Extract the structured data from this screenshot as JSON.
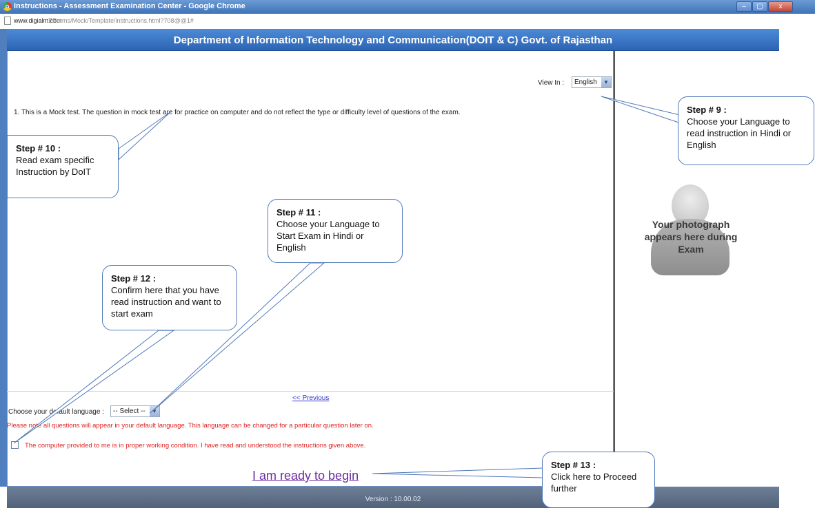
{
  "window": {
    "title": "Instructions - Assessment Examination Center - Google Chrome",
    "buttons": {
      "minimize": "–",
      "maximize": "▢",
      "close": "x"
    }
  },
  "address_bar": {
    "host": "www.digialm.com",
    "path": "/EForms/Mock/Template/instructions.html?708@@1#"
  },
  "header": {
    "title": "Department of Information Technology and Communication(DOIT & C) Govt. of Rajasthan"
  },
  "view_in": {
    "label": "View In :",
    "selected": "English"
  },
  "instructions": [
    "1.  This is a Mock test. The question in mock test are for practice on computer and do not reflect the type or difficulty level of questions of the exam."
  ],
  "photo_panel": {
    "text": "Your photograph appears here during Exam"
  },
  "navigation": {
    "previous": "<< Previous"
  },
  "default_language": {
    "label": "Choose your default language :",
    "selected": "-- Select --"
  },
  "note": "Please note all questions will appear in your default language. This language can be changed for a particular question later on.",
  "confirmation": {
    "text": "The computer provided to me is in proper working condition. I have read and understood the instructions given above.",
    "checked": false
  },
  "ready_button": "I am ready to begin",
  "footer": {
    "version": "Version : 10.00.02"
  },
  "callouts": {
    "step9": {
      "title": "Step # 9 :",
      "text": "Choose your Language to read instruction in Hindi or English"
    },
    "step10": {
      "title": "Step # 10 :",
      "text": "Read exam specific Instruction by DoIT"
    },
    "step11": {
      "title": "Step # 11 :",
      "text": "Choose your Language to Start Exam in Hindi or English"
    },
    "step12": {
      "title": "Step # 12 :",
      "text": "Confirm here that you have read instruction and want to start exam"
    },
    "step13": {
      "title": "Step # 13 :",
      "text": "Click here to Proceed further"
    }
  },
  "colors": {
    "header_blue": "#2c64b4",
    "warning_red": "#e02020",
    "link_purple": "#6a2aa0",
    "callout_border": "#4e79b7"
  }
}
